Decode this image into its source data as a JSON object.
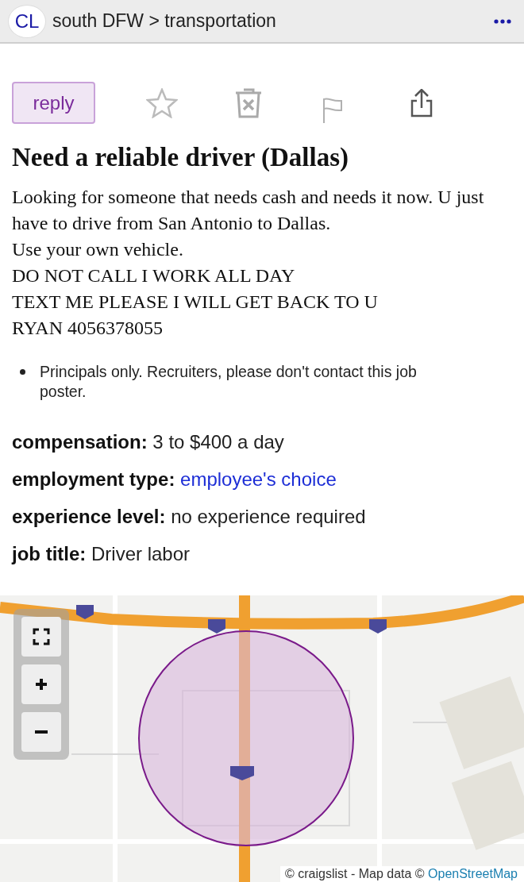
{
  "header": {
    "logo": "CL",
    "breadcrumb": "south DFW > transportation"
  },
  "toolbar": {
    "reply": "reply"
  },
  "posting": {
    "title": "Need a reliable driver (Dallas)",
    "body": [
      "Looking for someone that needs cash and needs it now. U just have to drive from San Antonio to Dallas.",
      "Use your own vehicle.",
      "DO NOT CALL I WORK ALL DAY",
      "TEXT ME PLEASE I WILL GET BACK TO U",
      "RYAN 4056378055"
    ],
    "notices": [
      "Principals only. Recruiters, please don't contact this job poster."
    ],
    "attributes": [
      {
        "label": "compensation:",
        "value": "3 to $400 a day",
        "kind": "text"
      },
      {
        "label": "employment type:",
        "value": "employee's choice",
        "kind": "link"
      },
      {
        "label": "experience level:",
        "value": "no experience required",
        "kind": "text"
      },
      {
        "label": "job title:",
        "value": "Driver labor",
        "kind": "text"
      }
    ]
  },
  "map": {
    "kind": "picture",
    "attribution": "© craigslist - Map data © ",
    "attribution_link": "OpenStreetMap"
  }
}
